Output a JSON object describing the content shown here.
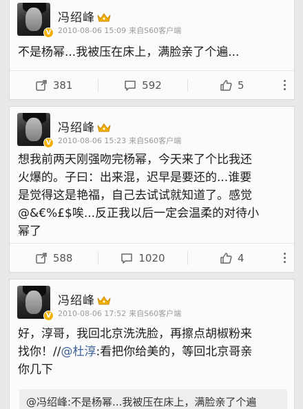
{
  "posts": [
    {
      "author": "冯绍峰",
      "time": "2010-08-06 15:09",
      "source": "来自S60客户端",
      "text": "不是杨幂...我被压在床上，满脸亲了个遍...",
      "reposts": "381",
      "comments": "592",
      "likes": "5"
    },
    {
      "author": "冯绍峰",
      "time": "2010-08-06 15:23",
      "source": "来自S60客户端",
      "text_lines": [
        "想我前两天刚强吻完杨幂，今天来了个比我还",
        "火爆的。子曰：出来混，迟早是要还的...谁要",
        "是觉得这是艳福，自己去试试就知道了。感觉",
        "@&€%£$唉...反正我以后一定会温柔的对待小",
        "幂了"
      ],
      "reposts": "588",
      "comments": "1020",
      "likes": "4"
    },
    {
      "author": "冯绍峰",
      "time": "2010-08-06 17:52",
      "source": "来自S60客户端",
      "text_lines": [
        "好，淳哥，我回北京洗洗脸，再擦点胡椒粉来",
        "找你！//",
        "看把你给美的，等回北京哥亲",
        "你几下"
      ],
      "mention": "@杜淳",
      "mention_suffix": ":",
      "quote": "@冯绍峰:不是杨幂...我被压在床上，满脸亲了个遍"
    }
  ],
  "icons": {
    "verified": "V",
    "repost": "repost-icon",
    "comment": "comment-icon",
    "like": "like-icon",
    "more": "more-icon",
    "crown": "crown-icon"
  }
}
